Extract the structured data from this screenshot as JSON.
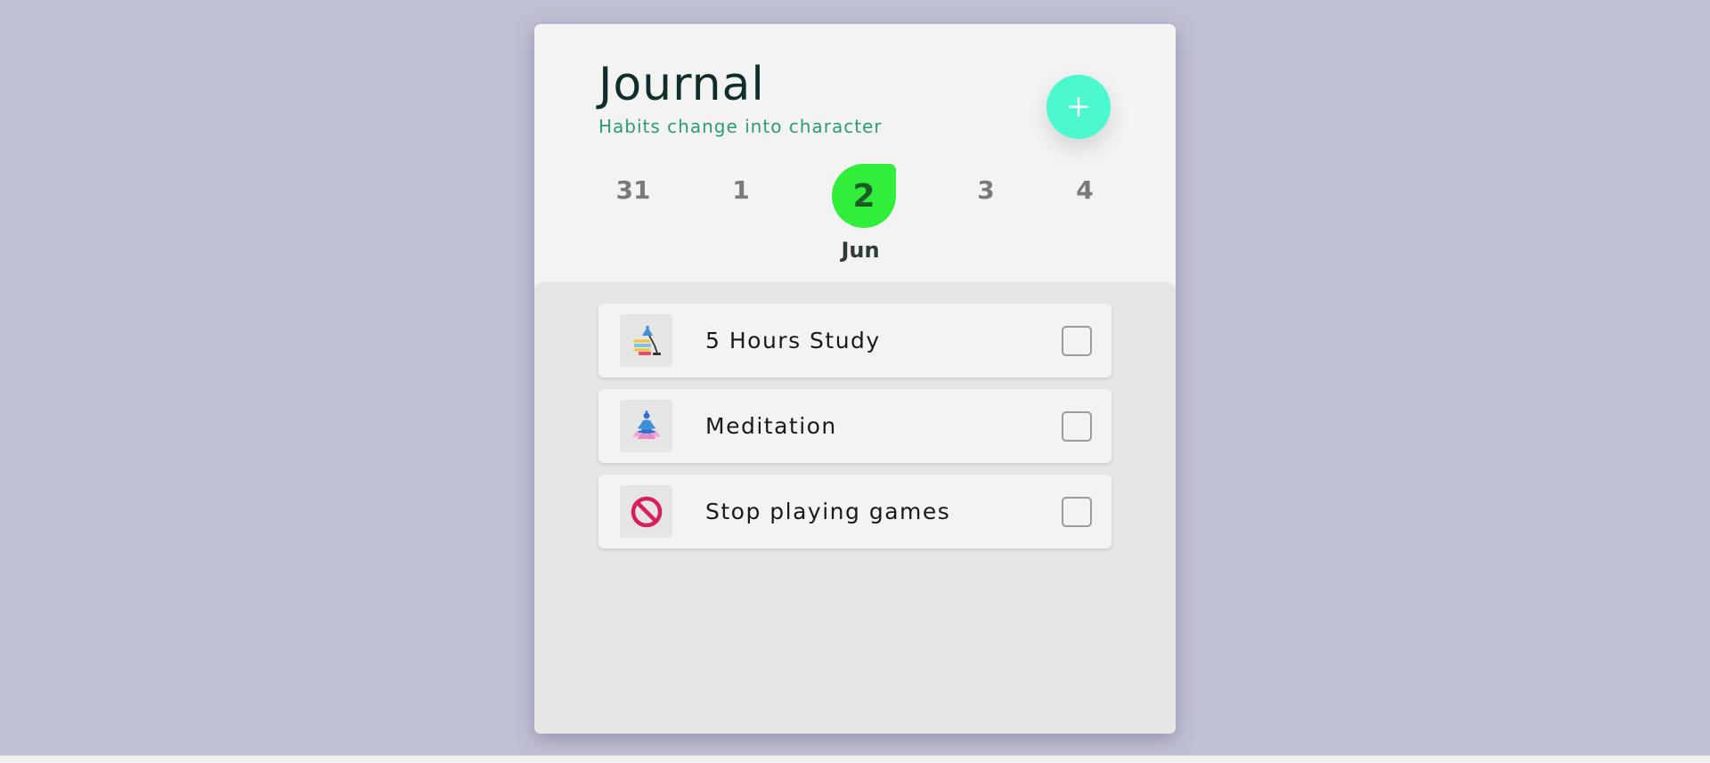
{
  "header": {
    "title": "Journal",
    "subtitle": "Habits change into character",
    "add_button_label": "+"
  },
  "date_strip": {
    "dates": [
      "31",
      "1",
      "2",
      "3",
      "4"
    ],
    "selected_index": 2,
    "selected_month": "Jun",
    "selected_color": "#31ee3a"
  },
  "habits": [
    {
      "label": "5 Hours Study",
      "icon": "study-desk-lamp-icon",
      "checked": false
    },
    {
      "label": "Meditation",
      "icon": "meditation-icon",
      "checked": false
    },
    {
      "label": "Stop playing games",
      "icon": "prohibited-icon",
      "checked": false
    }
  ],
  "colors": {
    "background": "#c0c0d5",
    "accent": "#4cf9cf",
    "subtitle": "#2e9a7a",
    "title": "#0f2d2a"
  }
}
